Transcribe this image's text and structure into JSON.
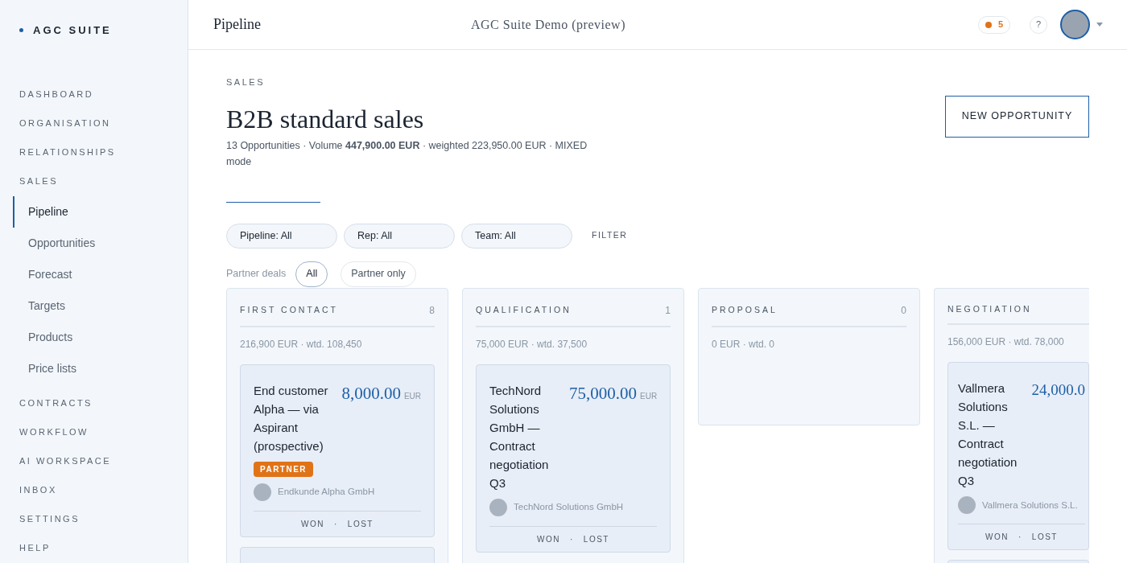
{
  "brand": "AGC SUITE",
  "nav": [
    {
      "label": "DASHBOARD"
    },
    {
      "label": "ORGANISATION"
    },
    {
      "label": "RELATIONSHIPS"
    },
    {
      "label": "SALES",
      "children": [
        {
          "label": "Pipeline",
          "selected": true
        },
        {
          "label": "Opportunities",
          "selected": false
        },
        {
          "label": "Forecast",
          "selected": false
        },
        {
          "label": "Targets",
          "selected": false
        },
        {
          "label": "Products",
          "selected": false
        },
        {
          "label": "Price lists",
          "selected": false
        }
      ]
    },
    {
      "label": "CONTRACTS"
    },
    {
      "label": "WORKFLOW"
    },
    {
      "label": "AI WORKSPACE"
    },
    {
      "label": "INBOX"
    },
    {
      "label": "SETTINGS"
    },
    {
      "label": "HELP"
    }
  ],
  "header": {
    "title": "Pipeline",
    "center": "AGC Suite Demo (preview)",
    "notifications": "5",
    "help": "?"
  },
  "page": {
    "eyebrow": "SALES",
    "title": "B2B standard sales",
    "summary": "13 Opportunities · Volume **447,900.00 EUR** · weighted 223,950.00 EUR · MIXED mode",
    "action": "NEW OPPORTUNITY"
  },
  "filters": [
    {
      "label": "Pipeline: All"
    },
    {
      "label": "Rep: All"
    },
    {
      "label": "Team: All"
    }
  ],
  "filter_button": "FILTER",
  "partner_deals": {
    "label": "Partner deals",
    "options": [
      {
        "label": "All",
        "selected": true
      },
      {
        "label": "Partner only",
        "selected": false
      }
    ]
  },
  "columns": [
    {
      "title": "FIRST CONTACT",
      "count": "8",
      "totals": "216,900 EUR · wtd. 108,450",
      "more": true,
      "cards": [
        {
          "title": "End customer Alpha — via Aspirant (prospective)",
          "amount": "8,000.00",
          "currency": "EUR",
          "badge": "PARTNER",
          "account": "Endkunde Alpha GmbH",
          "won": "WON",
          "sep": "·",
          "lost": "LOST"
        }
      ]
    },
    {
      "title": "QUALIFICATION",
      "count": "1",
      "totals": "75,000 EUR · wtd. 37,500",
      "more": false,
      "cards": [
        {
          "title": "TechNord Solutions GmbH — Contract negotiation Q3",
          "amount": "75,000.00",
          "currency": "EUR",
          "account": "TechNord Solutions GmbH",
          "won": "WON",
          "sep": "·",
          "lost": "LOST"
        }
      ]
    },
    {
      "title": "PROPOSAL",
      "count": "0",
      "totals": "0 EUR · wtd. 0",
      "more": false
    },
    {
      "title": "NEGOTIATION",
      "totals": "156,000 EUR · wtd. 78,000",
      "more": true,
      "cards": [
        {
          "title": "Vallmera Solutions S.L. — Contract negotiation Q3",
          "amount": "24,000.0",
          "account": "Vallmera Solutions S.L.",
          "won": "WON",
          "sep": "·",
          "lost": "LOST"
        }
      ]
    }
  ]
}
